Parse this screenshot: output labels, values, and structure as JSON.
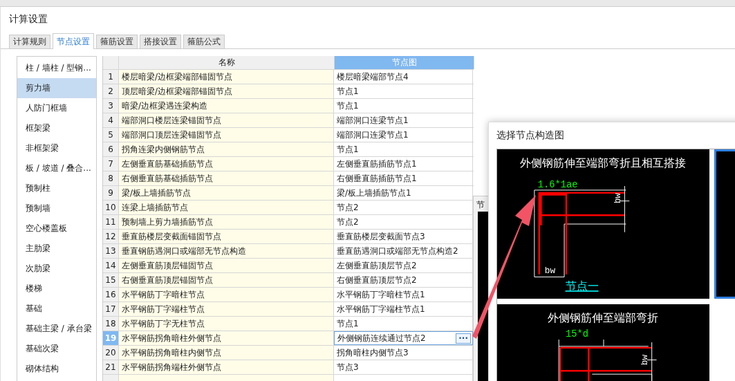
{
  "window": {
    "title": "计算设置"
  },
  "tabs": [
    {
      "label": "计算规则",
      "selected": false
    },
    {
      "label": "节点设置",
      "selected": true
    },
    {
      "label": "箍筋设置",
      "selected": false
    },
    {
      "label": "搭接设置",
      "selected": false
    },
    {
      "label": "箍筋公式",
      "selected": false
    }
  ],
  "sidebar": {
    "items": [
      {
        "label": "柱 / 墙柱 / 型钢...",
        "selected": false
      },
      {
        "label": "剪力墙",
        "selected": true
      },
      {
        "label": "人防门框墙",
        "selected": false
      },
      {
        "label": "框架梁",
        "selected": false
      },
      {
        "label": "非框架梁",
        "selected": false
      },
      {
        "label": "板 / 坡道 / 叠合...",
        "selected": false
      },
      {
        "label": "预制柱",
        "selected": false
      },
      {
        "label": "预制墙",
        "selected": false
      },
      {
        "label": "空心楼盖板",
        "selected": false
      },
      {
        "label": "主肋梁",
        "selected": false
      },
      {
        "label": "次肋梁",
        "selected": false
      },
      {
        "label": "楼梯",
        "selected": false
      },
      {
        "label": "基础",
        "selected": false
      },
      {
        "label": "基础主梁 / 承台梁",
        "selected": false
      },
      {
        "label": "基础次梁",
        "selected": false
      },
      {
        "label": "砌体结构",
        "selected": false
      }
    ]
  },
  "table": {
    "columns": [
      "名称",
      "节点图"
    ],
    "rows": [
      {
        "index": "1",
        "name": "楼层暗梁/边框梁端部锚固节点",
        "node": "楼层暗梁端部节点4",
        "selected": false
      },
      {
        "index": "2",
        "name": "顶层暗梁/边框梁端部锚固节点",
        "node": "节点1",
        "selected": false
      },
      {
        "index": "3",
        "name": "暗梁/边框梁遇连梁构造",
        "node": "节点1",
        "selected": false
      },
      {
        "index": "4",
        "name": "端部洞口楼层连梁锚固节点",
        "node": "端部洞口连梁节点1",
        "selected": false
      },
      {
        "index": "5",
        "name": "端部洞口顶层连梁锚固节点",
        "node": "端部洞口连梁节点1",
        "selected": false
      },
      {
        "index": "6",
        "name": "拐角连梁内侧钢筋节点",
        "node": "节点1",
        "selected": false
      },
      {
        "index": "7",
        "name": "左侧垂直筋基础插筋节点",
        "node": "左侧垂直筋插筋节点1",
        "selected": false
      },
      {
        "index": "8",
        "name": "右侧垂直筋基础插筋节点",
        "node": "右侧垂直筋插筋节点1",
        "selected": false
      },
      {
        "index": "9",
        "name": "梁/板上墙插筋节点",
        "node": "梁/板上墙插筋节点1",
        "selected": false
      },
      {
        "index": "10",
        "name": "连梁上墙插筋节点",
        "node": "节点2",
        "selected": false
      },
      {
        "index": "11",
        "name": "预制墙上剪力墙插筋节点",
        "node": "节点2",
        "selected": false
      },
      {
        "index": "12",
        "name": "垂直筋楼层变截面锚固节点",
        "node": "垂直筋楼层变截面节点3",
        "selected": false
      },
      {
        "index": "13",
        "name": "垂直钢筋遇洞口或端部无节点构造",
        "node": "垂直筋遇洞口或端部无节点构造2",
        "selected": false
      },
      {
        "index": "14",
        "name": "左侧垂直筋顶层锚固节点",
        "node": "左侧垂直筋顶层节点2",
        "selected": false
      },
      {
        "index": "15",
        "name": "右侧垂直筋顶层锚固节点",
        "node": "右侧垂直筋顶层节点2",
        "selected": false
      },
      {
        "index": "16",
        "name": "水平钢筋丁字暗柱节点",
        "node": "水平钢筋丁字暗柱节点1",
        "selected": false
      },
      {
        "index": "17",
        "name": "水平钢筋丁字端柱节点",
        "node": "水平钢筋丁字端柱节点1",
        "selected": false
      },
      {
        "index": "18",
        "name": "水平钢筋丁字无柱节点",
        "node": "节点1",
        "selected": false
      },
      {
        "index": "19",
        "name": "水平钢筋拐角暗柱外侧节点",
        "node": "外侧钢筋连续通过节点2",
        "selected": true
      },
      {
        "index": "20",
        "name": "水平钢筋拐角暗柱内侧节点",
        "node": "拐角暗柱内侧节点3",
        "selected": false
      },
      {
        "index": "21",
        "name": "水平钢筋拐角端柱外侧节点",
        "node": "节点3",
        "selected": false
      }
    ]
  },
  "edit_button": "···",
  "background_window": {
    "title": "节"
  },
  "node_picker": {
    "title": "选择节点构造图",
    "cards": [
      {
        "title": "外侧钢筋伸至端部弯折且相互搭接",
        "dimension": "1.6*1ae",
        "side_label": "bw",
        "bottom_label": "bw",
        "caption": "节点一",
        "selected": false
      },
      {
        "title": "外侧钢筋伸至端部弯折",
        "dimension": "15*d",
        "side_label": "bw",
        "selected": false
      }
    ],
    "side_card": {
      "selected": true
    }
  }
}
